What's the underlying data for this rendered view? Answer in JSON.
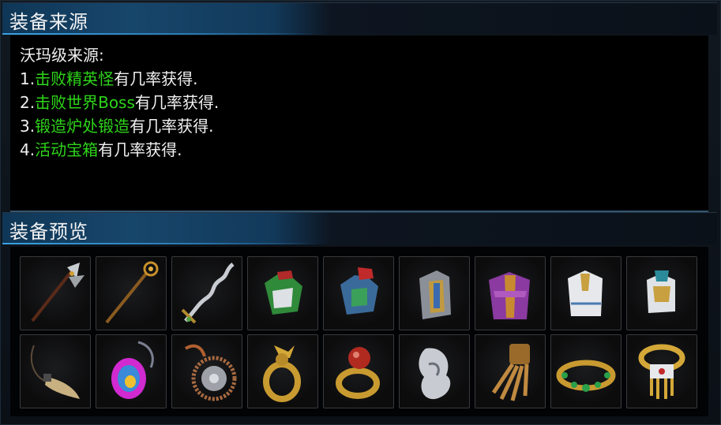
{
  "sections": {
    "source_title": "装备来源",
    "preview_title": "装备预览"
  },
  "source": {
    "heading": "沃玛级来源:",
    "items": [
      {
        "num": "1.",
        "highlight": "击败精英怪",
        "suffix": "有几率获得."
      },
      {
        "num": "2.",
        "highlight": "击败世界Boss",
        "suffix": "有几率获得."
      },
      {
        "num": "3.",
        "highlight": "锻造炉处锻造",
        "suffix": "有几率获得."
      },
      {
        "num": "4.",
        "highlight": "活动宝箱",
        "suffix": "有几率获得."
      }
    ]
  },
  "colors": {
    "highlight_green": "#2ed51a",
    "header_blue": "#17466b",
    "slot_border": "#3a3a3c"
  },
  "equipment_icons": [
    "axe-weapon-icon",
    "staff-weapon-icon",
    "serpent-sword-icon",
    "green-armor-icon",
    "blue-red-armor-icon",
    "grey-robe-armor-icon",
    "purple-robe-armor-icon",
    "white-tunic-armor-icon",
    "white-vest-armor-icon",
    "tooth-necklace-icon",
    "rainbow-gem-amulet-icon",
    "bead-medallion-icon",
    "dragon-ring-icon",
    "ruby-gold-ring-icon",
    "silver-claw-ring-icon",
    "skeletal-gauntlet-icon",
    "emerald-belt-icon",
    "ornate-bracelet-icon"
  ]
}
